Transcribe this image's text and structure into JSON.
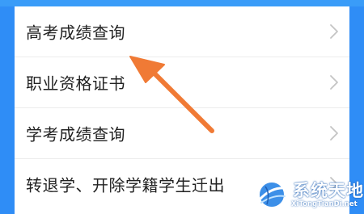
{
  "menu": {
    "items": [
      {
        "label": "高考成绩查询",
        "chevron": "chevron-right-icon"
      },
      {
        "label": "职业资格证书",
        "chevron": "chevron-right-icon"
      },
      {
        "label": "学考成绩查询",
        "chevron": "chevron-right-icon"
      },
      {
        "label": "转退学、开除学籍学生迁出",
        "chevron": "chevron-right-icon"
      }
    ]
  },
  "annotation": {
    "icon": "pointer-arrow-icon",
    "color": "#f07a35"
  },
  "watermark": {
    "title": "系统天地",
    "url": "XiTongTianDi.net",
    "icon": "globe-logo-icon"
  },
  "colors": {
    "background": "#2f8df6",
    "card": "#ffffff",
    "text": "#222222",
    "chevron": "#c4c4c4"
  }
}
